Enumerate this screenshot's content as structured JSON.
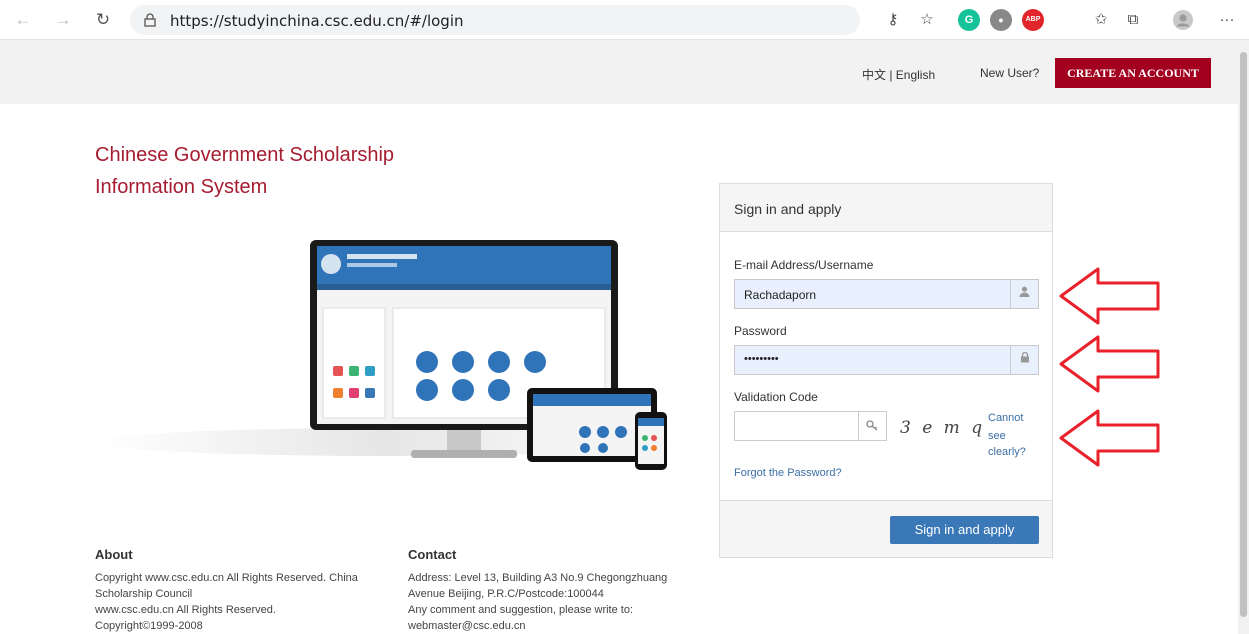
{
  "browser": {
    "url": "https://studyinchina.csc.edu.cn/#/login",
    "extensions": [
      {
        "name": "grammarly",
        "glyph": "G",
        "color": "#15c39a"
      },
      {
        "name": "record",
        "glyph": "●",
        "color": "#888888"
      },
      {
        "name": "adblock-plus",
        "glyph": "ABP",
        "color": "#e0262b"
      }
    ]
  },
  "header": {
    "language_switch": "中文 | English",
    "new_user": "New User?",
    "create_account": "CREATE AN ACCOUNT"
  },
  "titles": {
    "line1": "Chinese Government Scholarship",
    "line2": "Information System"
  },
  "login": {
    "panel_title": "Sign in and apply",
    "email_label": "E-mail Address/Username",
    "email_value": "Rachadaporn",
    "password_label": "Password",
    "password_value": "•••••••••",
    "validation_label": "Validation Code",
    "captcha_text": "3 e m q",
    "cannot_see_line1": "Cannot",
    "cannot_see_line2": "see",
    "cannot_see_line3": "clearly?",
    "forgot": "Forgot the Password?",
    "submit": "Sign in and apply"
  },
  "footer": {
    "about_title": "About",
    "about_lines": [
      "Copyright www.csc.edu.cn All Rights Reserved. China",
      "Scholarship Council",
      "www.csc.edu.cn All Rights Reserved.",
      "Copyright©1999-2008"
    ],
    "contact_title": "Contact",
    "contact_lines": [
      "Address: Level 13, Building A3 No.9 Chegongzhuang",
      "Avenue Beijing, P.R.C/Postcode:100044",
      "Any comment and suggestion, please write to:",
      "webmaster@csc.edu.cn"
    ]
  },
  "colors": {
    "brand_red": "#a3001f",
    "title_red": "#a61c30",
    "button_blue": "#3a78b8",
    "arrow_red": "#e8212a"
  }
}
